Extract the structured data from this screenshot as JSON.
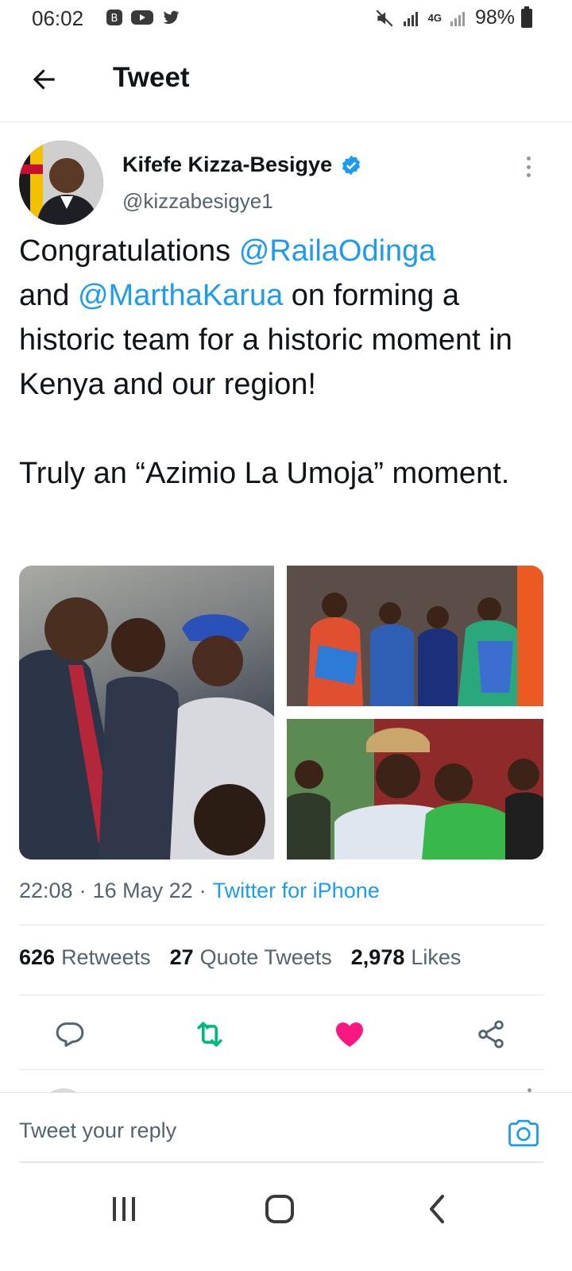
{
  "status_bar": {
    "time": "06:02",
    "network": "4G",
    "battery": "98%"
  },
  "header": {
    "title": "Tweet"
  },
  "tweet": {
    "author": {
      "name": "Kifefe Kizza-Besigye",
      "handle": "@kizzabesigye1",
      "verified": true
    },
    "text": {
      "p1_prefix": "Congratulations ",
      "mention_1": "@RailaOdinga",
      "p1_and": "and ",
      "mention_2": "@MarthaKarua",
      "p1_suffix": " on forming a historic team for a historic moment in Kenya and our region!",
      "p2": "Truly an “Azimio La Umoja” moment."
    },
    "time": "22:08",
    "date": "16 May 22",
    "source": "Twitter for iPhone",
    "stats": {
      "retweets_count": "626",
      "retweets_label": "Retweets",
      "quotes_count": "27",
      "quotes_label": "Quote Tweets",
      "likes_count": "2,978",
      "likes_label": "Likes"
    },
    "liked": true
  },
  "reply": {
    "placeholder": "Tweet your reply"
  },
  "colors": {
    "accent": "#1d9bf0",
    "like": "#f91880",
    "retweet": "#00ba7c",
    "text": "#0f1419",
    "secondary": "#536471"
  },
  "icons": {
    "back": "arrow-left-icon",
    "verified": "verified-badge-icon",
    "more": "more-vertical-icon",
    "reply": "reply-icon",
    "retweet": "retweet-icon",
    "like": "heart-filled-icon",
    "share": "share-icon",
    "camera": "camera-icon"
  }
}
